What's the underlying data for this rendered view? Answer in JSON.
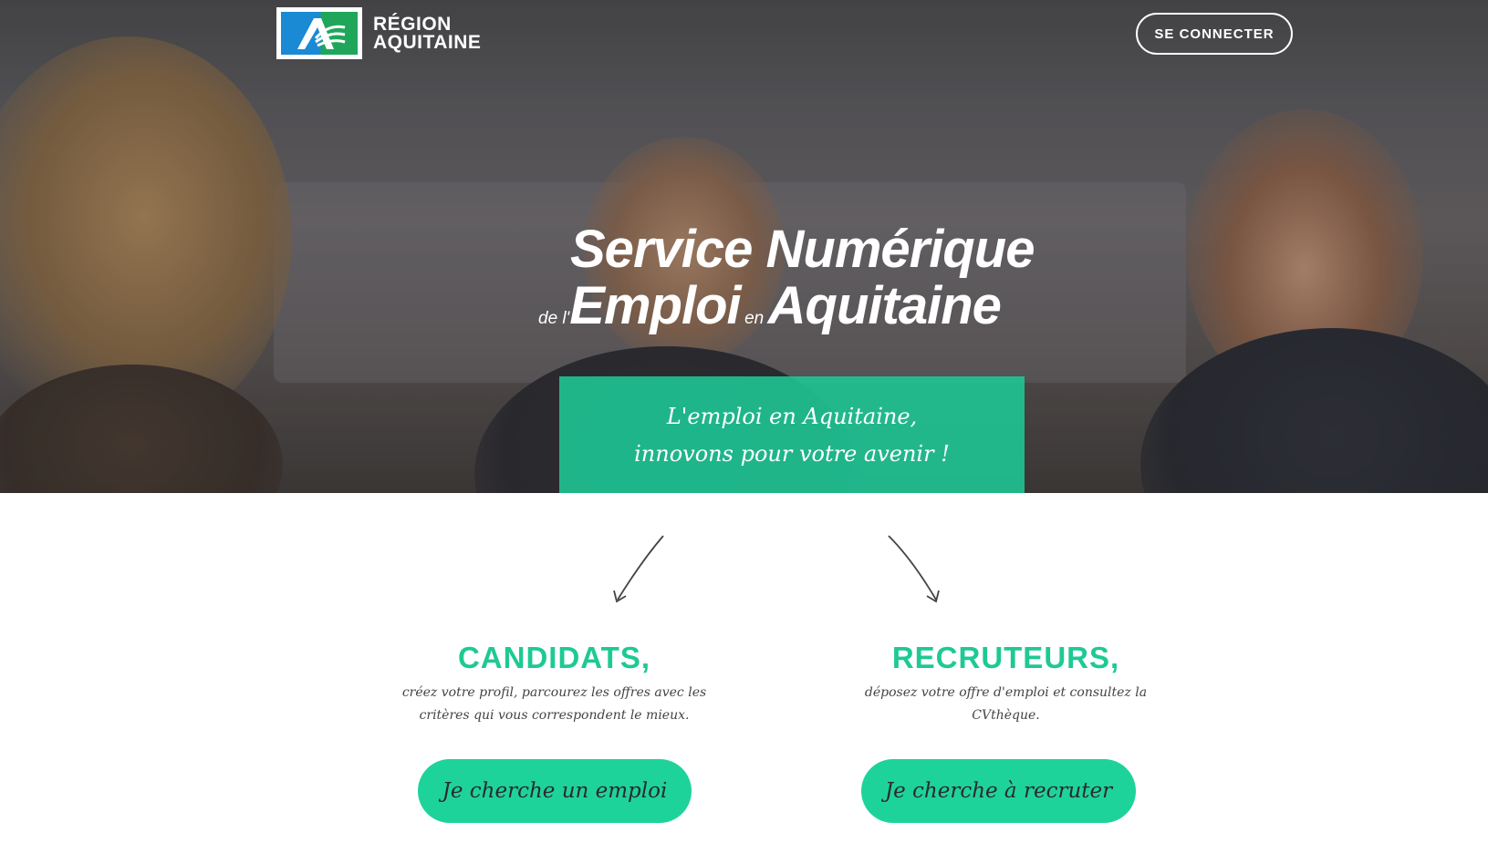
{
  "header": {
    "logo_line1": "RÉGION",
    "logo_line2": "AQUITAINE",
    "connect_label": "SE CONNECTER"
  },
  "hero": {
    "line1": "Service Numérique",
    "line2_prefix": "de l'",
    "line2_word1": "Emploi",
    "line2_connector": "en",
    "line2_word2": "Aquitaine",
    "tagline_line1": "L'emploi en Aquitaine,",
    "tagline_line2": "innovons pour votre avenir !"
  },
  "candidates": {
    "title": "CANDIDATS,",
    "desc_line1": "créez votre profil, parcourez les offres avec les",
    "desc_line2": "critères qui vous correspondent le mieux.",
    "button_label": "Je cherche un emploi"
  },
  "recruiters": {
    "title": "RECRUTEURS,",
    "desc_line1": "déposez votre offre d'emploi et consultez la",
    "desc_line2": "CVthèque.",
    "button_label": "Je cherche à recruter"
  },
  "colors": {
    "accent": "#1ed39a",
    "accent_title": "#1ec994",
    "tagline_bg": "#1ec896"
  }
}
